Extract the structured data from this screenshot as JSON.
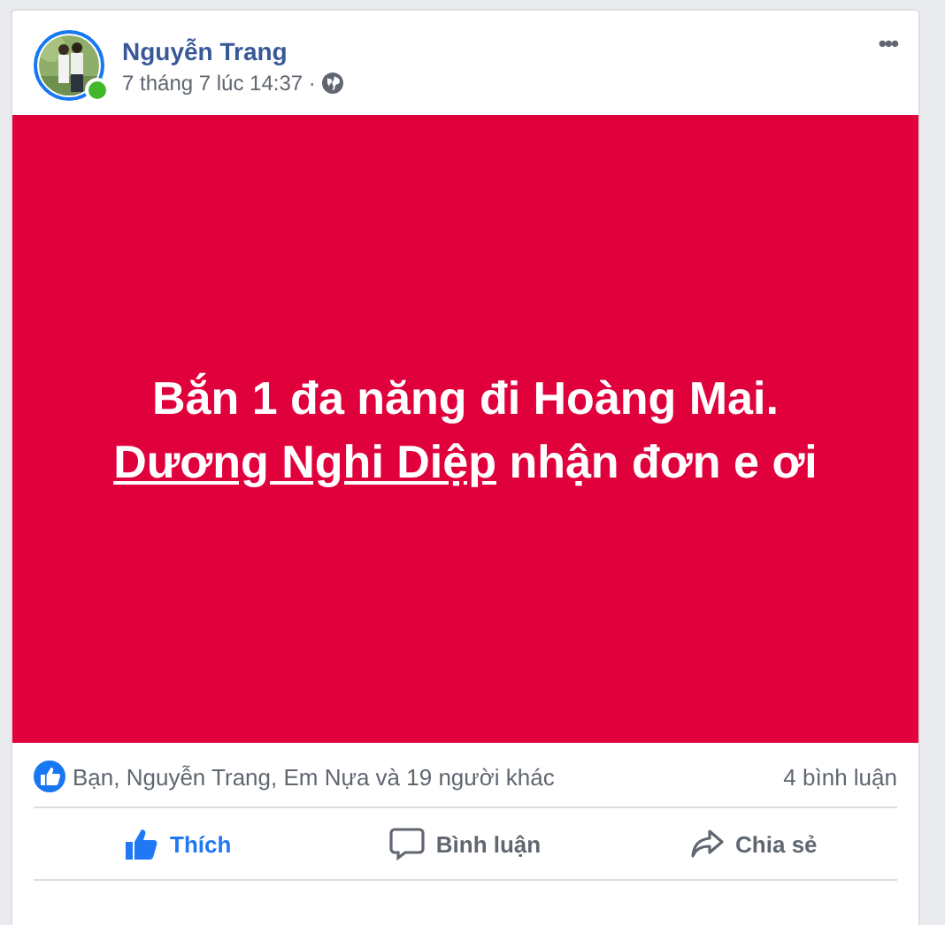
{
  "author": {
    "name": "Nguyễn Trang",
    "online": true
  },
  "timestamp": "7 tháng 7 lúc 14:37 ·",
  "more": "•••",
  "post": {
    "text_parts": [
      {
        "kind": "plain",
        "text": "Bắn 1 đa năng đi Hoàng Mai. "
      },
      {
        "kind": "mention",
        "text": "Dương Nghi Diệp"
      },
      {
        "kind": "plain",
        "text": " nhận đơn e ơi"
      }
    ]
  },
  "reactions": {
    "summary": "Bạn, Nguyễn Trang, Em Nựa và 19 người khác",
    "comments": "4 bình luận"
  },
  "actions": [
    {
      "kind": "like",
      "label": "Thích",
      "selected": true
    },
    {
      "kind": "comment",
      "label": "Bình luận",
      "selected": false
    },
    {
      "kind": "share",
      "label": "Chia sẻ",
      "selected": false
    }
  ]
}
